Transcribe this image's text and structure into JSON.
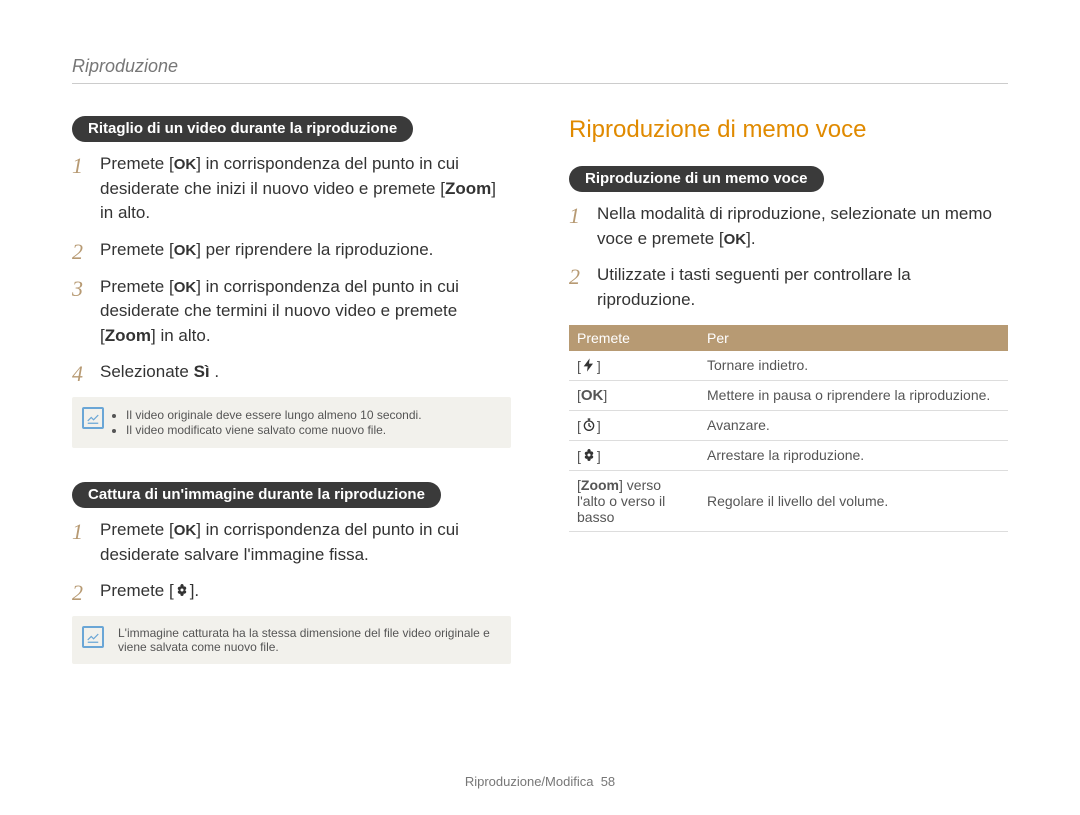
{
  "breadcrumb": "Riproduzione",
  "left": {
    "section1": {
      "pill": "Ritaglio di un video durante la riproduzione",
      "step1_a": "Premete [",
      "step1_b": "] in corrispondenza del punto in cui desiderate che inizi il nuovo video e premete [",
      "step1_zoom": "Zoom",
      "step1_c": "] in alto.",
      "step2_a": "Premete [",
      "step2_b": "] per riprendere la riproduzione.",
      "step3_a": "Premete [",
      "step3_b": "] in corrispondenza del punto in cui desiderate che termini il nuovo video e premete [",
      "step3_zoom": "Zoom",
      "step3_c": "] in alto.",
      "step4_a": "Selezionate ",
      "step4_b": "Sì",
      "step4_c": " .",
      "note1": "Il video originale deve essere lungo almeno 10 secondi.",
      "note2": "Il video modificato viene salvato come nuovo file."
    },
    "section2": {
      "pill": "Cattura di un'immagine durante la riproduzione",
      "step1_a": "Premete [",
      "step1_b": "] in corrispondenza del punto in cui desiderate salvare l'immagine fissa.",
      "step2_a": "Premete [",
      "step2_b": "].",
      "note": "L'immagine catturata ha la stessa dimensione del file video originale e viene salvata come nuovo file."
    }
  },
  "right": {
    "title": "Riproduzione di memo voce",
    "pill": "Riproduzione di un memo voce",
    "step1_a": "Nella modalità di riproduzione, selezionate un memo voce e premete [",
    "step1_b": "].",
    "step2": "Utilizzate i tasti seguenti per controllare la riproduzione.",
    "table": {
      "h1": "Premete",
      "h2": "Per",
      "r1_desc": "Tornare indietro.",
      "r2_desc": "Mettere in pausa o riprendere la riproduzione.",
      "r3_desc": "Avanzare.",
      "r4_desc": "Arrestare la riproduzione.",
      "r5_key_a": "[",
      "r5_key_zoom": "Zoom",
      "r5_key_b": "] verso l'alto o verso il basso",
      "r5_desc": "Regolare il livello del volume."
    }
  },
  "footer_a": "Riproduzione/Modifica",
  "footer_b": "58"
}
